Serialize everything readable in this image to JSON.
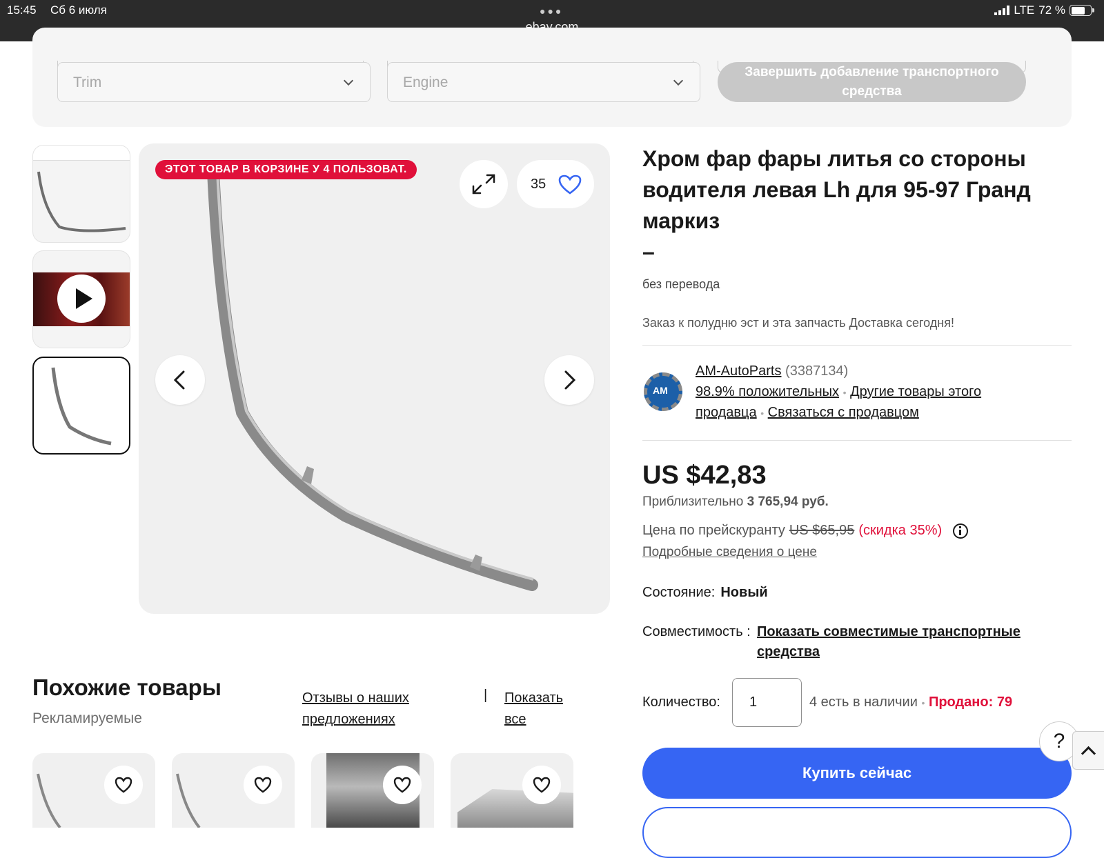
{
  "status_bar": {
    "time": "15:45",
    "date": "Сб 6 июля",
    "url": "ebay.com",
    "network": "LTE",
    "battery": "72 %",
    "battery_level": 0.72
  },
  "vehicle_form": {
    "trim_placeholder": "Trim",
    "engine_placeholder": "Engine",
    "finish_button": "Завершить добавление транспортного средства"
  },
  "gallery": {
    "cart_badge": "ЭТОТ ТОВАР В КОРЗИНЕ У 4 ПОЛЬЗОВАТ.",
    "watch_count": "35",
    "selected_thumb_index": 2,
    "thumb_count": 3
  },
  "product": {
    "title": "Хром фар фары литья со стороны водителя левая Lh для 95-97 Гранд маркиз",
    "title_dash": "–",
    "subtitle": "без перевода",
    "promo": "Заказ к полудню эст и эта запчасть Доставка сегодня!"
  },
  "seller": {
    "logo_text": "AM",
    "name": "AM-AutoParts",
    "feedback_count": "(3387134)",
    "positive": "98.9% положительных",
    "other_items_1": "Другие товары этого",
    "other_items_2": "продавца",
    "contact": "Связаться с продавцом"
  },
  "pricing": {
    "price": "US $42,83",
    "approx_label": "Приблизительно",
    "approx_value": "3 765,94 руб.",
    "list_label": "Цена по прейскуранту",
    "list_price": "US $65,95",
    "discount": "(скидка 35%)",
    "details_link": "Подробные сведения о цене"
  },
  "details": {
    "condition_label": "Состояние:",
    "condition_value": "Новый",
    "compat_label": "Совместимость :",
    "compat_link": "Показать совместимые транспортные средства",
    "qty_label": "Количество:",
    "qty_value": "1",
    "available": "4 есть в наличии",
    "sold": "Продано: 79"
  },
  "actions": {
    "buy_now": "Купить сейчас",
    "help": "?"
  },
  "similar": {
    "title": "Похожие товары",
    "subtitle": "Рекламируемые",
    "feedback_link": "Отзывы о наших предложениях",
    "separator": "|",
    "show_all": "Показать все"
  },
  "colors": {
    "accent_blue": "#3665f3",
    "sale_red": "#e0103a",
    "heart_blue": "#3665f3"
  }
}
